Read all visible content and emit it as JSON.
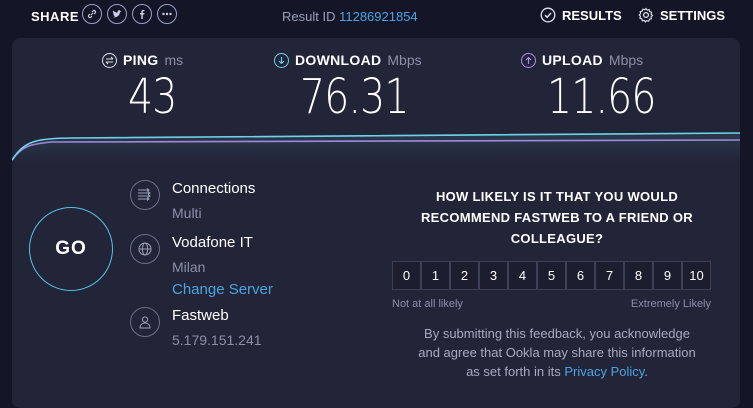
{
  "topbar": {
    "share_label": "SHARE",
    "share_icons": [
      "link-icon",
      "twitter-icon",
      "facebook-icon",
      "more-icon"
    ],
    "result_id_label": "Result ID",
    "result_id": "11286921854",
    "results_label": "RESULTS",
    "settings_label": "SETTINGS"
  },
  "metrics": {
    "ping": {
      "name": "PING",
      "unit": "ms",
      "value": "43"
    },
    "download": {
      "name": "DOWNLOAD",
      "unit": "Mbps",
      "value": "76.31"
    },
    "upload": {
      "name": "UPLOAD",
      "unit": "Mbps",
      "value": "11.66"
    }
  },
  "go_label": "GO",
  "server": {
    "connections_title": "Connections",
    "connections_value": "Multi",
    "host_title": "Vodafone IT",
    "host_location": "Milan",
    "change_server": "Change Server",
    "isp_title": "Fastweb",
    "isp_ip": "5.179.151.241"
  },
  "survey": {
    "question_line1": "HOW LIKELY IS IT THAT YOU WOULD",
    "question_line2": "RECOMMEND FASTWEB TO A FRIEND OR",
    "question_line3": "COLLEAGUE?",
    "scale": [
      "0",
      "1",
      "2",
      "3",
      "4",
      "5",
      "6",
      "7",
      "8",
      "9",
      "10"
    ],
    "low_label": "Not at all likely",
    "high_label": "Extremely Likely",
    "disclaimer_line1": "By submitting this feedback, you acknowledge",
    "disclaimer_line2": "and agree that Ookla may share this information",
    "disclaimer_line3_pre": "as set forth in its",
    "privacy_link": "Privacy Policy",
    "disclaimer_end": "."
  },
  "colors": {
    "accent_blue": "#4ba3e3",
    "download_line": "#6fd3e8",
    "upload_line": "#b38bf0"
  }
}
